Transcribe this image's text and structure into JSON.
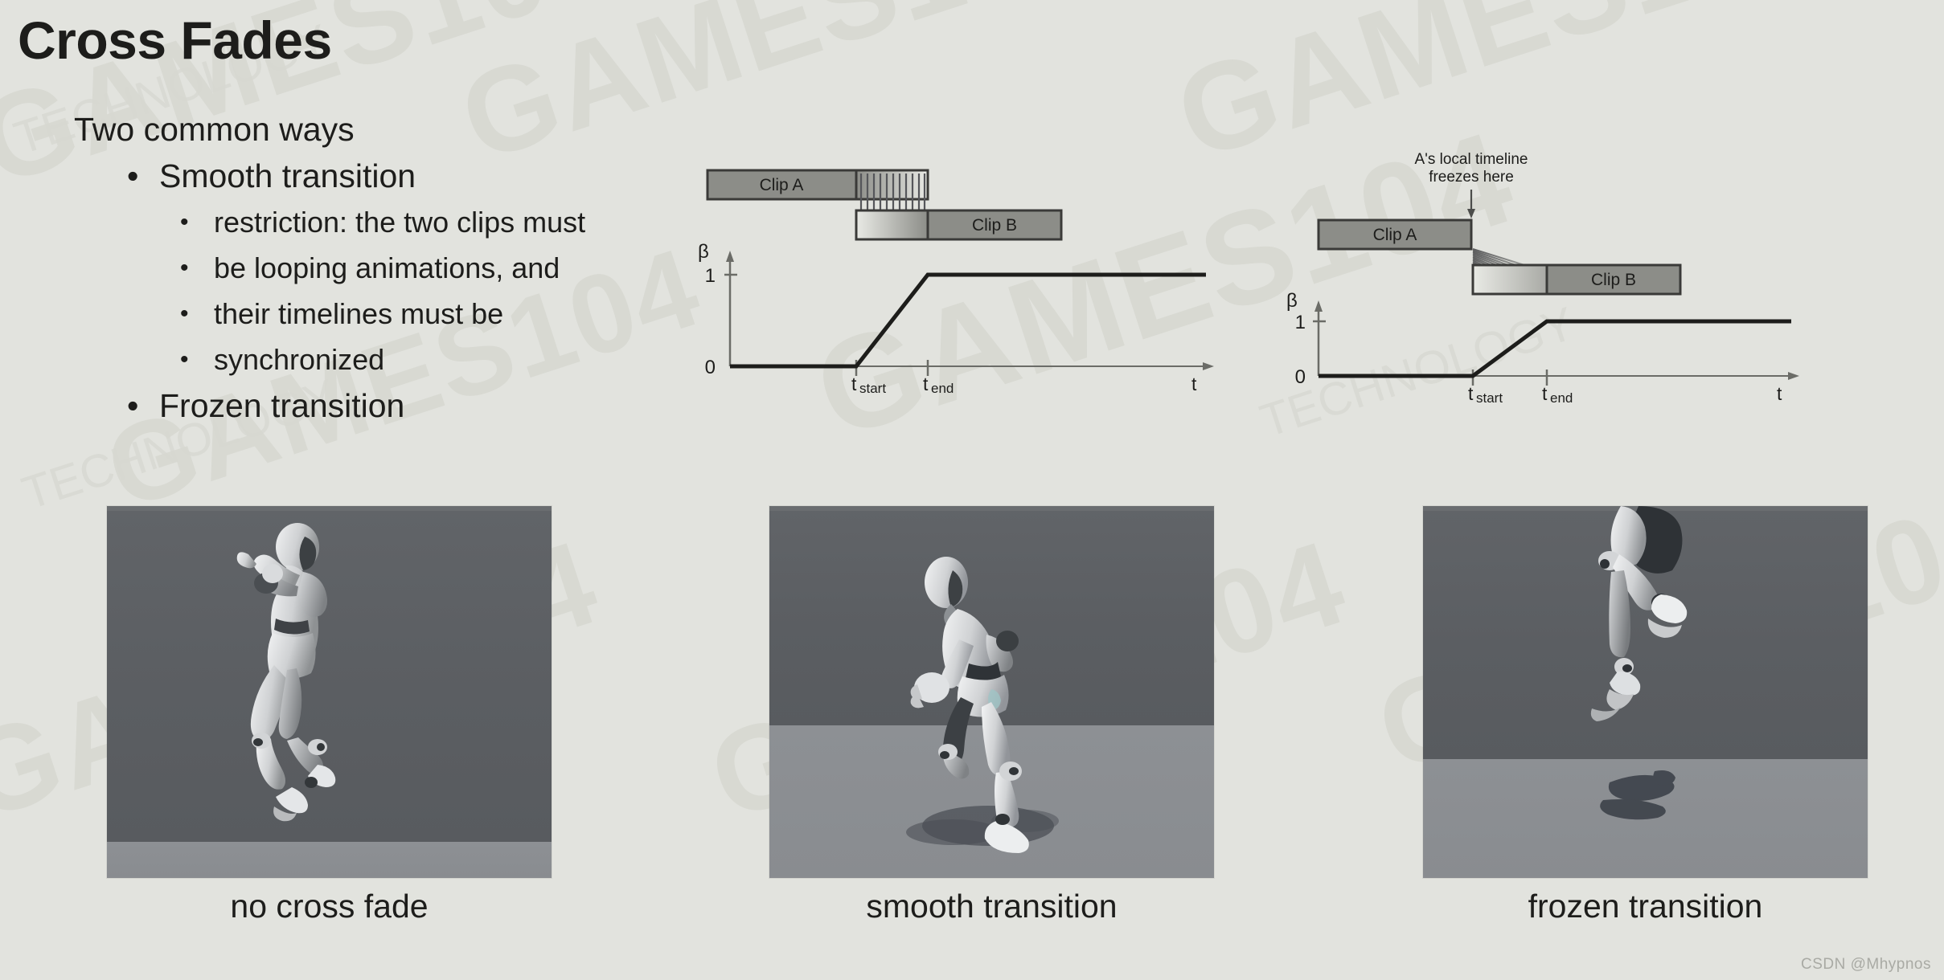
{
  "slide": {
    "title": "Cross Fades",
    "background_color": "#e2e3de",
    "text_color": "#1d1d1b",
    "watermark": "GAMES104",
    "watermark_small": "TECHNOLOGY",
    "credit": "CSDN @Mhypnos"
  },
  "bullets": {
    "lead": "Two common ways",
    "item1": "Smooth transition",
    "sub1_line1": "restriction: the two clips must",
    "sub1_line2": "be looping animations, and",
    "sub1_line3": "their timelines must be",
    "sub1_line4": "synchronized",
    "item2": "Frozen transition"
  },
  "diagram_smooth": {
    "name": "smooth-transition-diagram",
    "clip_a_label": "Clip A",
    "clip_b_label": "Clip B",
    "beta_label": "β",
    "y_tick_1": "1",
    "y_tick_0": "0",
    "t_start_label": "t",
    "t_start_sub": "start",
    "t_end_label": "t",
    "t_end_sub": "end",
    "t_axis_label": "t",
    "bar_fill": "#8c8d88",
    "bar_border": "#3a3a38"
  },
  "diagram_frozen": {
    "name": "frozen-transition-diagram",
    "annotation_line1": "A's local timeline",
    "annotation_line2": "freezes here",
    "clip_a_label": "Clip A",
    "clip_b_label": "Clip B",
    "beta_label": "β",
    "y_tick_1": "1",
    "y_tick_0": "0",
    "t_start_label": "t",
    "t_start_sub": "start",
    "t_end_label": "t",
    "t_end_sub": "end",
    "t_axis_label": "t",
    "bar_fill": "#8c8d88",
    "bar_border": "#3a3a38"
  },
  "panels": [
    {
      "caption": "no cross fade",
      "name": "panel-no-cross-fade"
    },
    {
      "caption": "smooth transition",
      "name": "panel-smooth-transition"
    },
    {
      "caption": "frozen transition",
      "name": "panel-frozen-transition"
    }
  ],
  "chart_data": [
    {
      "type": "line",
      "title": "Smooth transition blend weight",
      "xlabel": "t",
      "ylabel": "β",
      "ytick_labels": [
        "0",
        "1"
      ],
      "ylim": [
        0,
        1
      ],
      "xtick_labels": [
        "tstart",
        "tend"
      ],
      "x": [
        "0",
        "tstart",
        "tend",
        "end"
      ],
      "values": [
        0,
        0,
        1,
        1
      ],
      "grid": false,
      "legend": "none",
      "annotations": [
        "Clip A",
        "Clip B"
      ]
    },
    {
      "type": "line",
      "title": "Frozen transition blend weight",
      "xlabel": "t",
      "ylabel": "β",
      "ytick_labels": [
        "0",
        "1"
      ],
      "ylim": [
        0,
        1
      ],
      "xtick_labels": [
        "tstart",
        "tend"
      ],
      "x": [
        "0",
        "tstart",
        "tend",
        "end"
      ],
      "values": [
        0,
        0,
        1,
        1
      ],
      "grid": false,
      "legend": "none",
      "annotations": [
        "A's local timeline freezes here",
        "Clip A",
        "Clip B"
      ]
    }
  ]
}
